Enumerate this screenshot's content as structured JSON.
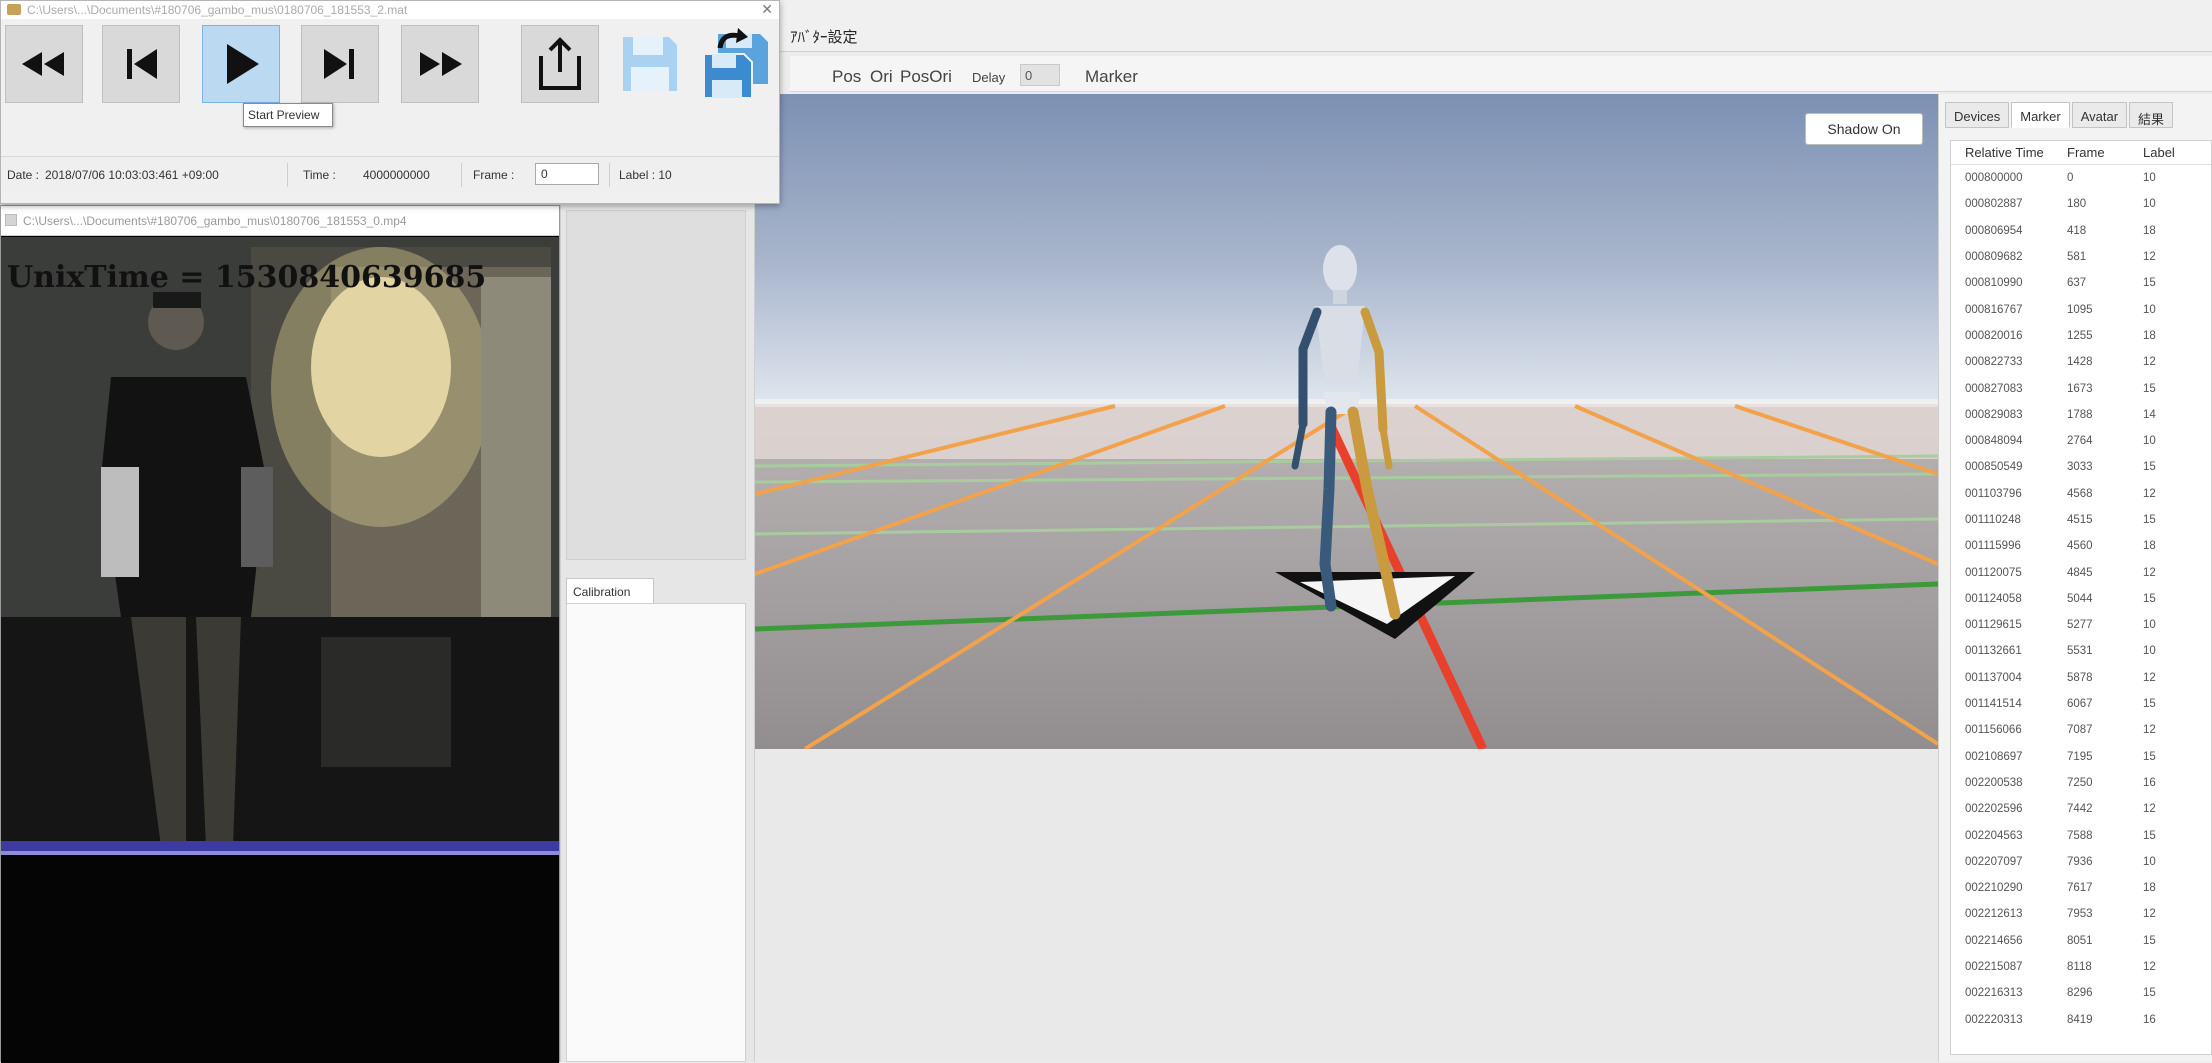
{
  "player": {
    "title": "C:\\Users\\...\\Documents\\#180706_gambo_mus\\0180706_181553_2.mat",
    "tooltip": "Start Preview",
    "status": {
      "date_label": "Date :",
      "date_value": "2018/07/06 10:03:03:461 +09:00",
      "time_label": "Time :",
      "time_value": "4000000000",
      "frame_label": "Frame :",
      "frame_value": "0",
      "label_text": "Label : 10"
    }
  },
  "camera": {
    "title": "C:\\Users\\...\\Documents\\#180706_gambo_mus\\0180706_181553_0.mp4",
    "overlay": "UnixTime = 1530840639685"
  },
  "app": {
    "menu": "ｱﾊﾞﾀｰ設定",
    "toolbar": {
      "pos": "Pos",
      "ori": "Ori",
      "posori": "PosOri",
      "delay_label": "Delay",
      "delay_value": "0",
      "marker": "Marker"
    },
    "shadow_button": "Shadow On"
  },
  "side_panel": {
    "calibration_tab": "Calibration"
  },
  "right_panel": {
    "tabs": [
      "Devices",
      "Marker",
      "Avatar",
      "結果"
    ],
    "active_tab": "Marker",
    "columns": [
      "Relative Time",
      "Frame",
      "Label"
    ],
    "rows": [
      [
        "000800000",
        "0",
        "10"
      ],
      [
        "000802887",
        "180",
        "10"
      ],
      [
        "000806954",
        "418",
        "18"
      ],
      [
        "000809682",
        "581",
        "12"
      ],
      [
        "000810990",
        "637",
        "15"
      ],
      [
        "000816767",
        "1095",
        "10"
      ],
      [
        "000820016",
        "1255",
        "18"
      ],
      [
        "000822733",
        "1428",
        "12"
      ],
      [
        "000827083",
        "1673",
        "15"
      ],
      [
        "000829083",
        "1788",
        "14"
      ],
      [
        "000848094",
        "2764",
        "10"
      ],
      [
        "000850549",
        "3033",
        "15"
      ],
      [
        "001103796",
        "4568",
        "12"
      ],
      [
        "001110248",
        "4515",
        "15"
      ],
      [
        "001115996",
        "4560",
        "18"
      ],
      [
        "001120075",
        "4845",
        "12"
      ],
      [
        "001124058",
        "5044",
        "15"
      ],
      [
        "001129615",
        "5277",
        "10"
      ],
      [
        "001132661",
        "5531",
        "10"
      ],
      [
        "001137004",
        "5878",
        "12"
      ],
      [
        "001141514",
        "6067",
        "15"
      ],
      [
        "001156066",
        "7087",
        "12"
      ],
      [
        "002108697",
        "7195",
        "15"
      ],
      [
        "002200538",
        "7250",
        "16"
      ],
      [
        "002202596",
        "7442",
        "12"
      ],
      [
        "002204563",
        "7588",
        "15"
      ],
      [
        "002207097",
        "7936",
        "10"
      ],
      [
        "002210290",
        "7617",
        "18"
      ],
      [
        "002212613",
        "7953",
        "12"
      ],
      [
        "002214656",
        "8051",
        "15"
      ],
      [
        "002215087",
        "8118",
        "12"
      ],
      [
        "002216313",
        "8296",
        "15"
      ],
      [
        "002220313",
        "8419",
        "16"
      ]
    ]
  },
  "colors": {
    "active_button": "#bcd9f2",
    "grid_orange": "#f2a24a",
    "grid_red": "#e8402a",
    "grid_green": "#3c9a3a",
    "sky_top": "#7d90b3",
    "floor": "#9a9696"
  }
}
